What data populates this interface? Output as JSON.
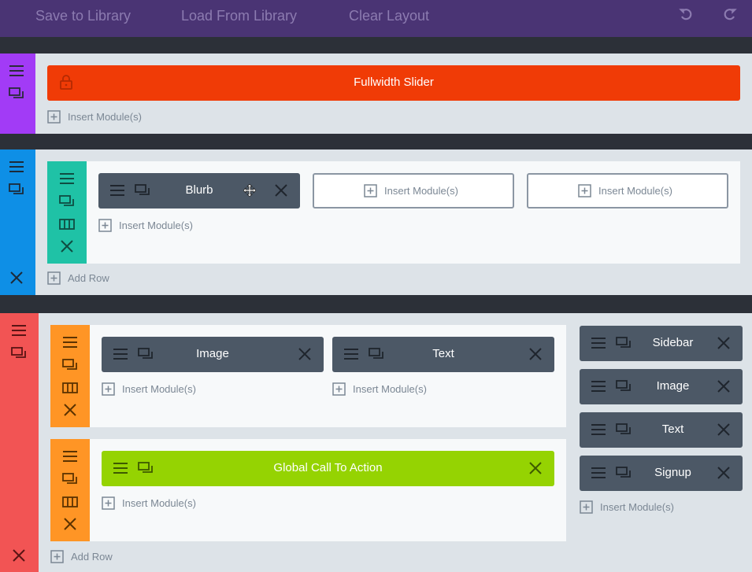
{
  "toolbar": {
    "save_label": "Save to Library",
    "load_label": "Load From Library",
    "clear_label": "Clear Layout",
    "undo_icon": "undo-icon",
    "redo_icon": "redo-icon"
  },
  "colors": {
    "toolbar_bg": "#4a3474",
    "section1_handle": "#a23bf6",
    "section2_handle": "#0e8fe6",
    "section3_handle": "#f25454",
    "row_handle_teal": "#1fc2a6",
    "row_handle_orange": "#ff9525",
    "module_dark": "#4c5866",
    "fullwidth_module": "#f03b06",
    "global_module": "#95d302"
  },
  "section1": {
    "fullwidth_module": {
      "label": "Fullwidth Slider",
      "icon": "lock-icon"
    },
    "insert_label": "Insert Module(s)"
  },
  "section2": {
    "row": {
      "columns": [
        {
          "module_label": "Blurb",
          "insert_label": "Insert Module(s)"
        },
        {
          "insert_label": "Insert Module(s)"
        },
        {
          "insert_label": "Insert Module(s)"
        }
      ]
    },
    "add_row_label": "Add Row"
  },
  "section3": {
    "row1": {
      "columns": [
        {
          "module_label": "Image",
          "insert_label": "Insert Module(s)"
        },
        {
          "module_label": "Text",
          "insert_label": "Insert Module(s)"
        }
      ]
    },
    "row2": {
      "module_label": "Global Call To Action",
      "insert_label": "Insert Module(s)"
    },
    "sidebar": {
      "modules": [
        "Sidebar",
        "Image",
        "Text",
        "Signup"
      ],
      "insert_label": "Insert Module(s)"
    },
    "add_row_label": "Add Row"
  }
}
